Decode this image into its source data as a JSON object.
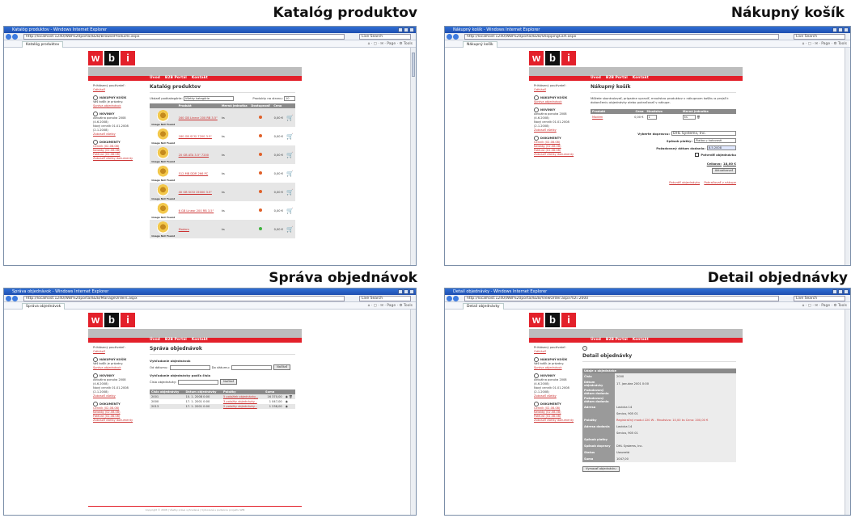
{
  "panels": [
    {
      "heading": "Katalóg produktov"
    },
    {
      "heading": "Nákupný košík"
    },
    {
      "heading": "Správa objednávok"
    },
    {
      "heading": "Detail objednávky"
    }
  ],
  "browser": {
    "title_suffix": " - Windows Internet Explorer",
    "search_placeholder": "Live Search",
    "tools": "⌂ · ▢ · ✉ · Page · ⚙ Tools"
  },
  "site": {
    "logo": [
      "w",
      "b",
      "i"
    ],
    "menu": [
      "Úvod",
      "B2B Portál",
      "Kontakt"
    ],
    "sidebar": {
      "logged_as": "Prihlásený používateľ:",
      "logout": "Odhlásiť",
      "cart_title": "NÁKUPNÝ KOŠÍK",
      "cart_empty": "Váš košík je prázdny.",
      "cart_link": "Správa objednávok",
      "news_title": "NOVINKY",
      "news_1": "Aktuálna ponuka 2008 (4.6.2008)",
      "news_2": "Nový cenník 01.01.2008 (2.1.2008)",
      "all_news": "Zobraziť všetky",
      "docs_title": "DOKUMENTY",
      "doc_1": "Cenník (02.08.08)",
      "doc_2": "Katalóg (02.08.08)",
      "doc_3": "Faktúra (02.08.08)",
      "all_docs": "Zobraziť všetky dokumenty"
    }
  },
  "catalog": {
    "window_title": "Katalóg produktov",
    "url": "http://localhost:1240/WBI%20portal/B2B/BrowseProducts.aspx",
    "tab": "Katalóg produktov",
    "page_title": "Katalóg produktov",
    "category_label": "Ukázať podkategórie:",
    "category_value": "Všetky kategórie",
    "page_size_label": "Produkty na stranu:",
    "page_size_value": "10",
    "columns": [
      "",
      "Produkt",
      "Merná jednotka",
      "Dostupnosť",
      "Cena",
      ""
    ],
    "image_caption": "Image Not Found",
    "rows": [
      {
        "name": "160 GB Linear 200 RB 3.5\"",
        "unit": "ks",
        "price": "0,00 €",
        "status_color": "#e0612a"
      },
      {
        "name": "180 GB SCSI 7200 3.5\"",
        "unit": "ks",
        "price": "0,00 €",
        "status_color": "#e0612a"
      },
      {
        "name": "20 GB ATA 3.5\" 7200",
        "unit": "ks",
        "price": "0,00 €",
        "status_color": "#e0612a"
      },
      {
        "name": "512 MB DDR 266 PC",
        "unit": "ks",
        "price": "0,00 €",
        "status_color": "#e0612a"
      },
      {
        "name": "40 GB SCSI 15000 3.5\"",
        "unit": "ks",
        "price": "0,00 €",
        "status_color": "#e0612a"
      },
      {
        "name": "6 GB Linear 200 RB 3.5\"",
        "unit": "ks",
        "price": "0,00 €",
        "status_color": "#e0612a"
      },
      {
        "name": "Modem",
        "unit": "ks",
        "price": "0,00 €",
        "status_color": "#3fb33f"
      }
    ]
  },
  "cart": {
    "window_title": "Nákupný košík",
    "url": "http://localhost:1240/WBI%20portal/B2B/ShoppingCart.aspx",
    "tab": "Nákupný košík",
    "page_title": "Nákupný košík",
    "intro": "Môžete skontrolovať, prípadne upraviť, množstvo produktov v nákupnom košíku a prejsť k dokončeniu objednávky alebo pokračovať v nákupe.",
    "columns": [
      "Produkt",
      "Cena",
      "Množstvo",
      "Merná jednotka"
    ],
    "item": {
      "name": "Modem",
      "price": "0,00 €",
      "qty": "1",
      "unit": "ks"
    },
    "customer_label": "Vyberte dopravcu:",
    "customer_value": "DHL Systems, Inc.",
    "payment_label": "Spôsob platby:",
    "payment_value": "Platba v hotovosti",
    "date_label": "Požadovaný dátum dodania:",
    "date_value": "8.5.2008",
    "confirm_label": "Potvrdiť objednávku",
    "total_label": "Celkovo:",
    "total_value": "18,00 €",
    "update_button": "Aktualizovať",
    "order_link": "Potvrdiť objednávku",
    "continue_link": "Pokračovať v nákupe"
  },
  "orders": {
    "window_title": "Správa objednávok",
    "url": "http://localhost:1240/WBI%20portal/B2B/ManageOrders.aspx",
    "tab": "Správa objednávok",
    "page_title": "Správa objednávok",
    "search_title": "Vyhľadanie objednávok",
    "from_label": "Od dátumu:",
    "to_label": "Do dátumu:",
    "load_button": "Načítať",
    "search_num_title": "Vyhľadanie objednávky podľa čísla",
    "num_label": "Číslo objednávky:",
    "columns": [
      "Číslo objednávky",
      "Dátum objednávky",
      "Položky",
      "Suma",
      ""
    ],
    "rows": [
      {
        "num": "2001",
        "date": "10. 1. 2008 0:00",
        "items": "5 položiek objednávky...",
        "sum": "16 370,00"
      },
      {
        "num": "2000",
        "date": "17. 1. 2001 0:00",
        "items": "3 položky objednávky...",
        "sum": "1 047,00"
      },
      {
        "num": "2013",
        "date": "17. 1. 2001 0:00",
        "items": "2 položky objednávky...",
        "sum": "1 238,00"
      }
    ],
    "footer": "Copyright © 2008 | Všetky práva vyhradené | Vytvorené s podporou projektu WBI"
  },
  "detail": {
    "window_title": "Detail objednávky",
    "url": "http://localhost:1240/WBI%20portal/B2B/ViewOrder.aspx?ID=2000",
    "tab": "Detail objednávky",
    "page_title": "Detail objednávky",
    "header": "Údaje o objednávke",
    "rows": [
      {
        "label": "Číslo",
        "value": "2000"
      },
      {
        "label": "Dátum objednávky",
        "value": "17. januára 2001 0:00"
      },
      {
        "label": "Požadovaný dátum dodania",
        "value": ""
      },
      {
        "label": "Požadovaný dátum dodania",
        "value": ""
      },
      {
        "label": "Adresa",
        "value": "Lavicka 14"
      },
      {
        "label": "",
        "value": "Senica, 905 01"
      },
      {
        "label": "Položky",
        "value": "Registračný modul 220 W - Množstvo: 10,00 ks  Cena: 200,00 €"
      },
      {
        "label": "Adresa dodania",
        "value": "Lavicka 14"
      },
      {
        "label": "",
        "value": "Senica, 905 01"
      },
      {
        "label": "Spôsob platby",
        "value": ""
      },
      {
        "label": "Spôsob dopravy",
        "value": "DHL Systems, Inc."
      },
      {
        "label": "Status",
        "value": "Uzavretá"
      },
      {
        "label": "Suma",
        "value": "1047,00"
      }
    ],
    "delete_button": "Vymazať objednávku"
  }
}
